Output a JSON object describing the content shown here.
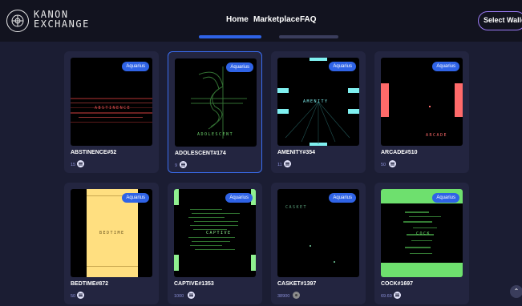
{
  "header": {
    "logo_line1": "KANON",
    "logo_line2": "EXCHANGE",
    "nav": [
      "Home",
      "Marketplace",
      "FAQ"
    ],
    "wallet_button": "Select Wallet"
  },
  "cards": [
    {
      "title": "ABSTINENCE#52",
      "price": "15",
      "badge": "Aquarius",
      "art_word": "ABSTINENCE",
      "art_color": "#e05050",
      "currency_icon": "sol-icon"
    },
    {
      "title": "ADOLESCENT#174",
      "price": "9",
      "badge": "Aquarius",
      "art_word": "ADOLESCENT",
      "art_color": "#6fd86f",
      "currency_icon": "sol-icon"
    },
    {
      "title": "AMENITY#354",
      "price": "11",
      "badge": "Aquarius",
      "art_word": "AMENITY",
      "art_color": "#7ff0f0",
      "currency_icon": "sol-icon"
    },
    {
      "title": "ARCADE#510",
      "price": "50",
      "badge": "Aquarius",
      "art_word": "ARCADE",
      "art_color": "#ff6a6a",
      "currency_icon": "sol-icon"
    },
    {
      "title": "BEDTIME#872",
      "price": "50",
      "badge": "Aquarius",
      "art_word": "BEDTIME",
      "art_color": "#ffdf80",
      "currency_icon": "sol-icon"
    },
    {
      "title": "CAPTIVE#1353",
      "price": "1000",
      "badge": "Aquarius",
      "art_word": "CAPTIVE",
      "art_color": "#8ff08f",
      "currency_icon": "sol-icon"
    },
    {
      "title": "CASKET#1397",
      "price": "38900",
      "badge": "Aquarius",
      "art_word": "CASKET",
      "art_color": "#5aa07a",
      "currency_icon": "token-icon"
    },
    {
      "title": "COCK#1697",
      "price": "69.69",
      "badge": "Aquarius",
      "art_word": "COCK",
      "art_color": "#6ee06e",
      "currency_icon": "sol-icon"
    }
  ],
  "colors": {
    "background": "#1b1d33",
    "header": "#12131f",
    "card": "#232540",
    "badge": "#2f63e6",
    "selected_border": "#3a6df0",
    "wallet_border": "#9b7bf5"
  }
}
